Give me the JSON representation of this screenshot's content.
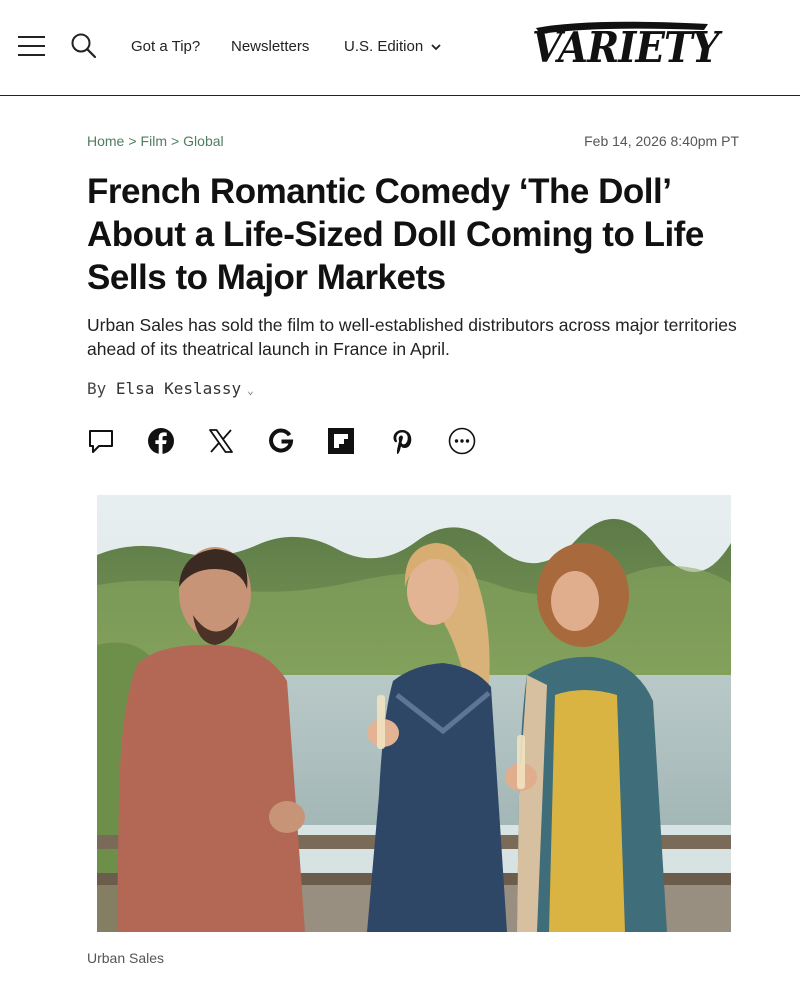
{
  "header": {
    "nav": {
      "tip": "Got a Tip?",
      "newsletters": "Newsletters",
      "edition": "U.S. Edition"
    },
    "logo": "VARIETY"
  },
  "article": {
    "breadcrumb": {
      "home": "Home",
      "film": "Film",
      "global": "Global",
      "separator": ">"
    },
    "date": "Feb 14, 2026 8:40pm PT",
    "headline": "French Romantic Comedy ‘The Doll’ About a Life-Sized Doll Coming to Life Sells to Major Markets",
    "dek": "Urban Sales has sold the film to well-established distributors across major territories ahead of its theatrical launch in France in April.",
    "byline": {
      "prefix": "By",
      "author": "Elsa Keslassy"
    },
    "share_icons": [
      "comment-icon",
      "facebook-icon",
      "x-icon",
      "google-icon",
      "flipboard-icon",
      "pinterest-icon",
      "more-icon"
    ],
    "photo_caption": "Urban Sales"
  },
  "colors": {
    "breadcrumb": "#4e7e5e",
    "text": "#111111",
    "divider": "#222222"
  }
}
